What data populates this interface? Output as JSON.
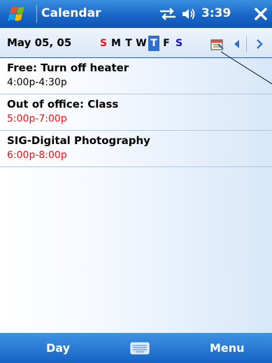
{
  "titlebar": {
    "app_title": "Calendar",
    "clock": "3:39",
    "start_icon": "windows-flag-icon",
    "connectivity_icon": "connectivity-arrows-icon",
    "volume_icon": "speaker-icon",
    "close_icon": "close-x-icon"
  },
  "nav": {
    "date": "May 05, 05",
    "weekdays": [
      "S",
      "M",
      "T",
      "W",
      "T",
      "F",
      "S"
    ],
    "today_index": 4,
    "goto_today_icon": "calendar-today-icon",
    "prev_icon": "triangle-left-icon",
    "next_icon": "chevron-right-icon"
  },
  "appointments": [
    {
      "subject": "Free: Turn off heater",
      "time": "4:00p-4:30p",
      "time_color": "#000000"
    },
    {
      "subject": "Out of office: Class",
      "time": "5:00p-7:00p",
      "time_color": "#e11111"
    },
    {
      "subject": "SIG-Digital Photography",
      "time": "6:00p-8:00p",
      "time_color": "#e11111"
    }
  ],
  "menubar": {
    "left_softkey": "Day",
    "right_softkey": "Menu",
    "input_icon": "keyboard-icon"
  },
  "colors": {
    "titlebar_blue": "#1866c8",
    "weekend_sunday": "#e11111",
    "weekend_saturday": "#1111cc",
    "today_highlight": "#2e6fd0"
  }
}
